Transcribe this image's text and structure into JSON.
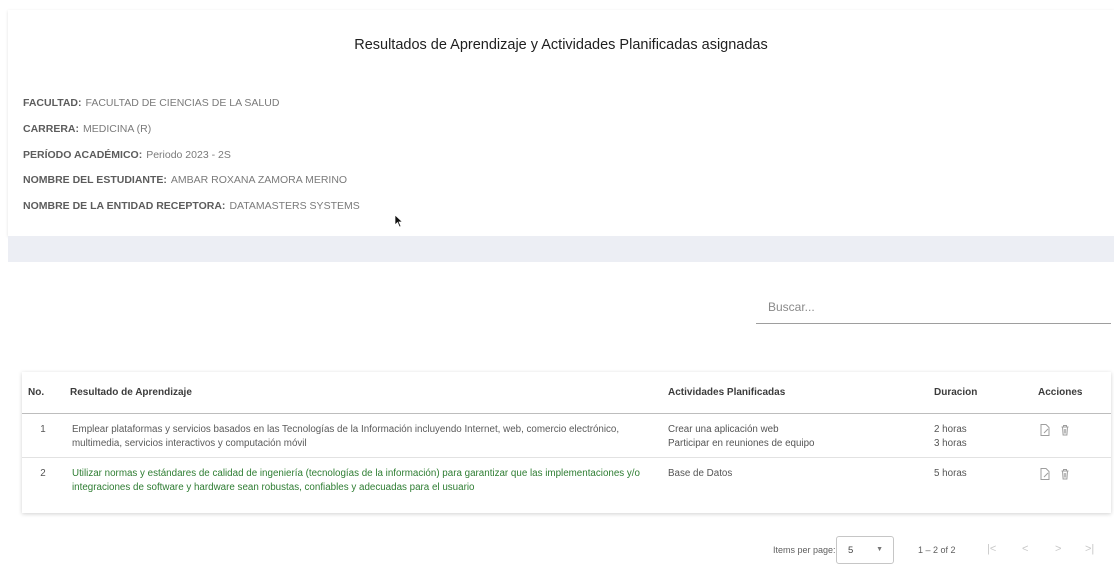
{
  "header": {
    "title": "Resultados de Aprendizaje y Actividades Planificadas asignadas",
    "fields": [
      {
        "label": "FACULTAD:",
        "value": "FACULTAD DE CIENCIAS DE LA SALUD"
      },
      {
        "label": "CARRERA:",
        "value": "MEDICINA (R)"
      },
      {
        "label": "PERÍODO ACADÉMICO:",
        "value": "Periodo 2023 - 2S"
      },
      {
        "label": "NOMBRE DEL ESTUDIANTE:",
        "value": "AMBAR ROXANA ZAMORA MERINO"
      },
      {
        "label": "NOMBRE DE LA ENTIDAD RECEPTORA:",
        "value": "DATAMASTERS SYSTEMS"
      }
    ]
  },
  "search": {
    "placeholder": "Buscar...",
    "value": ""
  },
  "table": {
    "columns": [
      "No.",
      "Resultado de Aprendizaje",
      "Actividades Planificadas",
      "Duracion",
      "Acciones"
    ],
    "rows": [
      {
        "no": "1",
        "resultado": "Emplear plataformas y servicios basados en las Tecnologías de la Información incluyendo Internet, web, comercio electrónico, multimedia, servicios interactivos y computación móvil",
        "actividades": [
          "Crear una aplicación web",
          "Participar en reuniones de equipo"
        ],
        "duraciones": [
          "2 horas",
          "3 horas"
        ]
      },
      {
        "no": "2",
        "resultado": "Utilizar normas y estándares de calidad de ingeniería (tecnologías de la información) para garantizar que las implementaciones y/o integraciones de software y hardware sean robustas, confiables y adecuadas para el usuario",
        "actividades": [
          "Base de Datos"
        ],
        "duraciones": [
          "5 horas"
        ]
      }
    ],
    "action_icons": [
      "edit-icon",
      "delete-icon"
    ]
  },
  "paginator": {
    "items_per_page_label": "Items per page:",
    "items_per_page": "5",
    "range": "1 – 2 of 2",
    "first": "|<",
    "prev": "<",
    "next": ">",
    "last": ">|"
  },
  "colors": {
    "band": "#eceef4",
    "label": "#5c5c5c",
    "value": "#7a7a7a",
    "green_text": "#2e7d32"
  }
}
